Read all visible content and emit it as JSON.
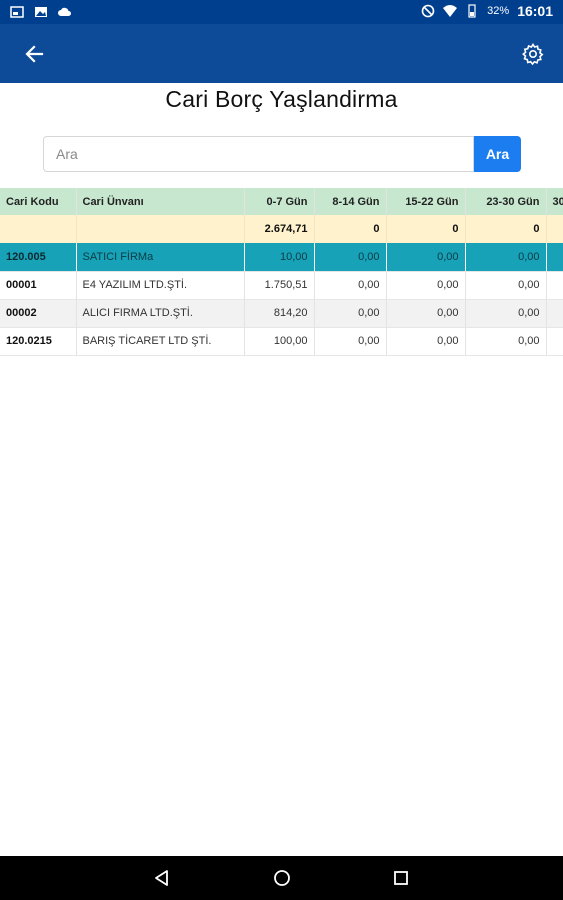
{
  "status": {
    "battery_percent": "32%",
    "time": "16:01"
  },
  "page": {
    "title": "Cari Borç Yaşlandirma"
  },
  "search": {
    "placeholder": "Ara",
    "value": "",
    "button_label": "Ara"
  },
  "table": {
    "columns": [
      "Cari Kodu",
      "Cari Ünvanı",
      "0-7 Gün",
      "8-14 Gün",
      "15-22 Gün",
      "23-30 Gün",
      "30"
    ],
    "totals": [
      "",
      "",
      "2.674,71",
      "0",
      "0",
      "0",
      ""
    ],
    "rows": [
      {
        "code": "120.005",
        "name": "SATICI FİRMa",
        "v1": "10,00",
        "v2": "0,00",
        "v3": "0,00",
        "v4": "0,00",
        "selected": true
      },
      {
        "code": "00001",
        "name": "E4 YAZILIM LTD.ŞTİ.",
        "v1": "1.750,51",
        "v2": "0,00",
        "v3": "0,00",
        "v4": "0,00",
        "selected": false
      },
      {
        "code": "00002",
        "name": "ALICI FIRMA LTD.ŞTİ.",
        "v1": "814,20",
        "v2": "0,00",
        "v3": "0,00",
        "v4": "0,00",
        "selected": false
      },
      {
        "code": "120.0215",
        "name": "BARIŞ TİCARET LTD ŞTİ.",
        "v1": "100,00",
        "v2": "0,00",
        "v3": "0,00",
        "v4": "0,00",
        "selected": false
      }
    ]
  },
  "colors": {
    "status_bar": "#003f8e",
    "app_bar": "#0d4b98",
    "header_row": "#c7e8cf",
    "totals_row": "#fff2cc",
    "selected_row": "#17a2b8",
    "search_button": "#1b7df0"
  },
  "icons": {
    "back": "arrow-left-icon",
    "settings": "gear-icon",
    "nav_back": "triangle-back-icon",
    "nav_home": "circle-home-icon",
    "nav_recents": "square-recents-icon"
  }
}
